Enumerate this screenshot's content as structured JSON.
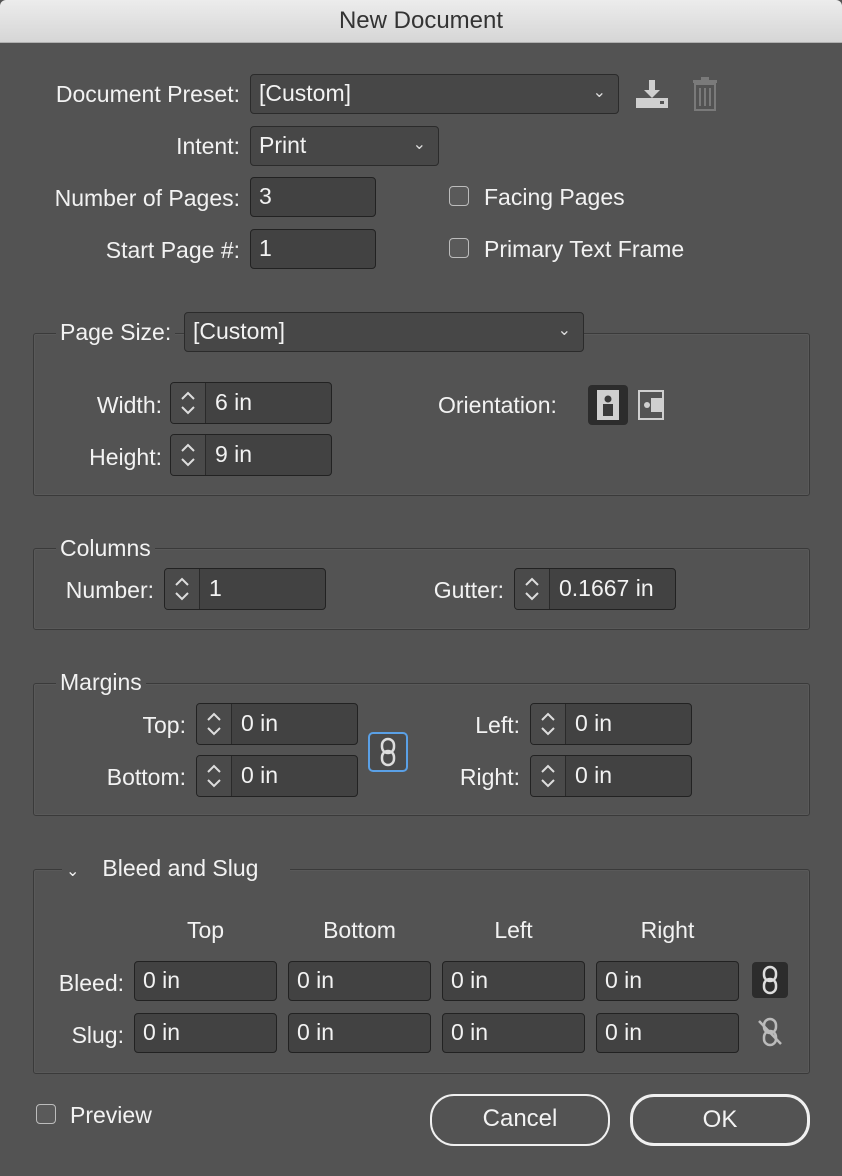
{
  "window": {
    "title": "New Document"
  },
  "preset": {
    "label": "Document Preset:",
    "value": "[Custom]",
    "save_icon": "save-preset-icon",
    "delete_icon": "trash-icon"
  },
  "intent": {
    "label": "Intent:",
    "value": "Print"
  },
  "pages": {
    "label": "Number of Pages:",
    "value": "3"
  },
  "start_page": {
    "label": "Start Page #:",
    "value": "1"
  },
  "facing_pages": {
    "label": "Facing Pages",
    "checked": false
  },
  "primary_text_frame": {
    "label": "Primary Text Frame",
    "checked": false
  },
  "page_size": {
    "label": "Page Size:",
    "value": "[Custom]",
    "width_label": "Width:",
    "width": "6 in",
    "height_label": "Height:",
    "height": "9 in",
    "orientation_label": "Orientation:",
    "orientation": "portrait"
  },
  "columns": {
    "title": "Columns",
    "number_label": "Number:",
    "number": "1",
    "gutter_label": "Gutter:",
    "gutter": "0.1667 in"
  },
  "margins": {
    "title": "Margins",
    "top_label": "Top:",
    "top": "0 in",
    "bottom_label": "Bottom:",
    "bottom": "0 in",
    "left_label": "Left:",
    "left": "0 in",
    "right_label": "Right:",
    "right": "0 in"
  },
  "bleed_slug": {
    "title": "Bleed and Slug",
    "headers": [
      "Top",
      "Bottom",
      "Left",
      "Right"
    ],
    "bleed_label": "Bleed:",
    "bleed": [
      "0 in",
      "0 in",
      "0 in",
      "0 in"
    ],
    "slug_label": "Slug:",
    "slug": [
      "0 in",
      "0 in",
      "0 in",
      "0 in"
    ]
  },
  "preview": {
    "label": "Preview",
    "checked": false
  },
  "buttons": {
    "cancel": "Cancel",
    "ok": "OK"
  }
}
